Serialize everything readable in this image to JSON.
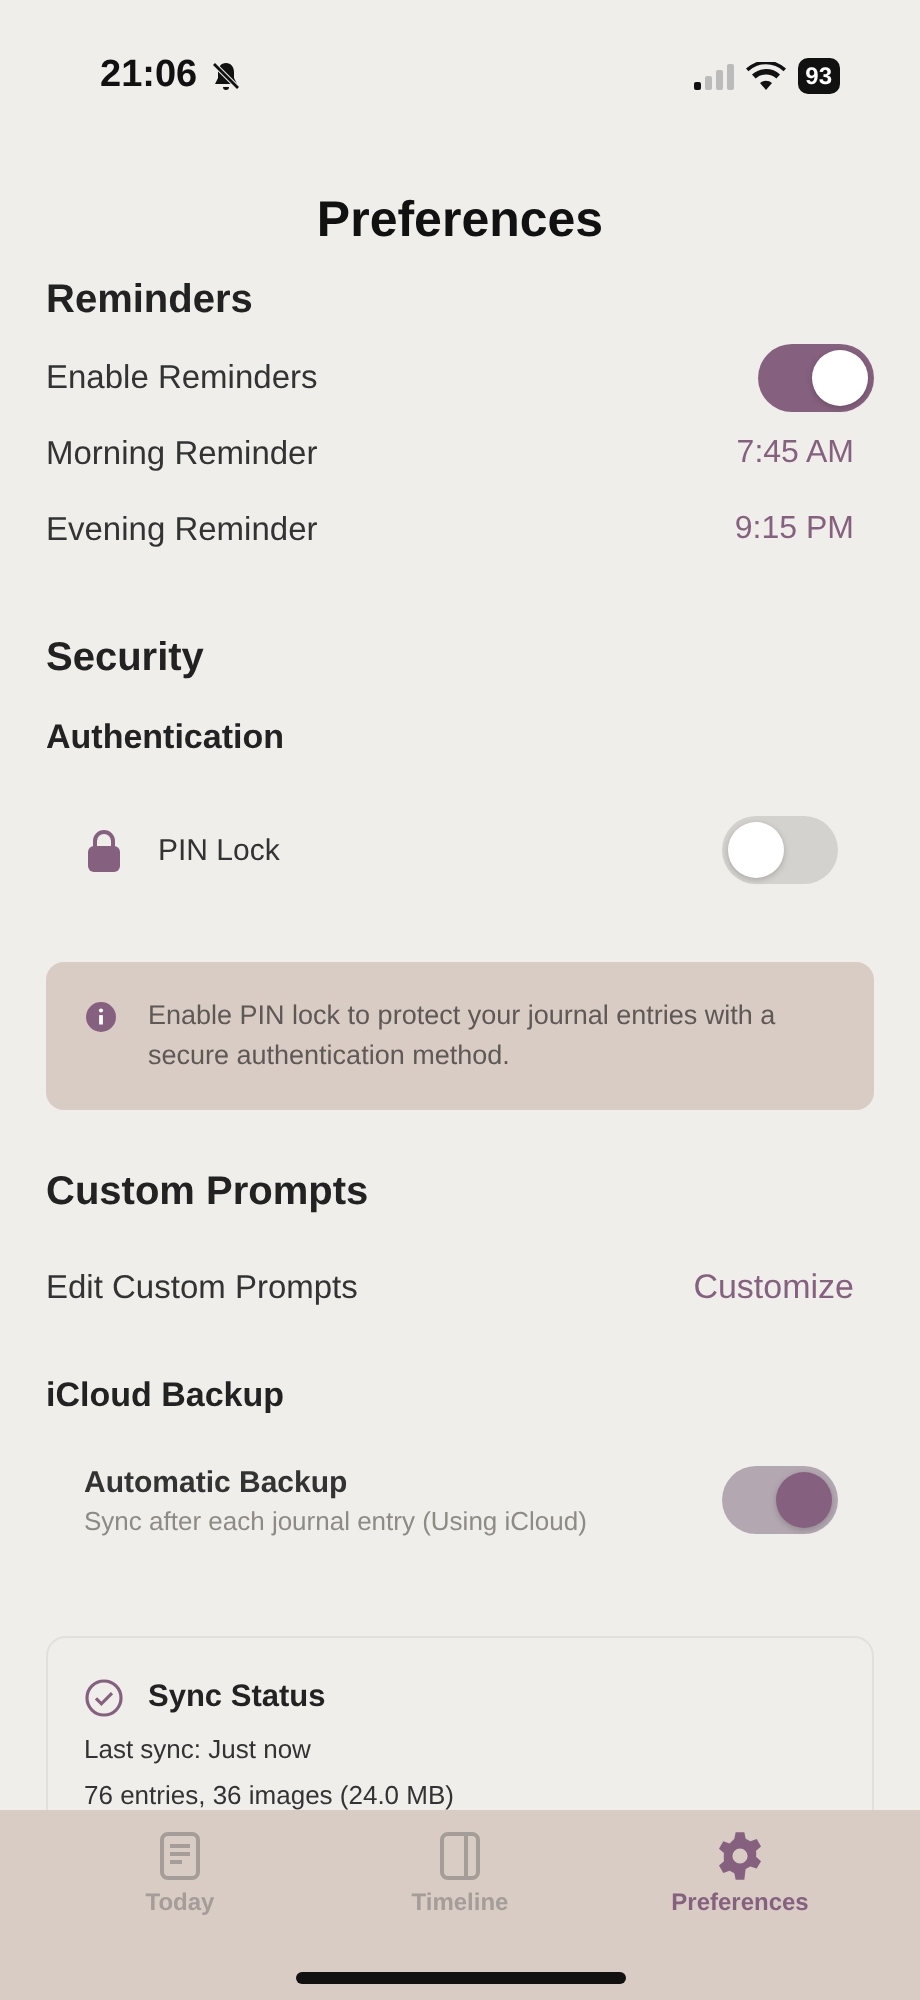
{
  "status_bar": {
    "time": "21:06",
    "silent": true,
    "battery": "93"
  },
  "title": "Preferences",
  "reminders": {
    "heading": "Reminders",
    "rows": [
      {
        "kind": "toggle",
        "label": "Enable Reminders",
        "on": true
      },
      {
        "kind": "time",
        "label": "Morning Reminder",
        "value": "7:45 AM"
      },
      {
        "kind": "time",
        "label": "Evening Reminder",
        "value": "9:15 PM"
      }
    ]
  },
  "security": {
    "heading": "Security",
    "subheading": "Authentication",
    "pin_lock": {
      "label": "PIN Lock",
      "on": false
    },
    "info": "Enable PIN lock to protect your journal entries with a secure authentication method."
  },
  "custom_prompts": {
    "heading": "Custom Prompts",
    "label": "Edit Custom Prompts",
    "action": "Customize"
  },
  "icloud_backup": {
    "heading": "iCloud Backup",
    "automatic_backup": {
      "label": "Automatic Backup",
      "description": "Sync after each journal entry (Using iCloud)",
      "on": true
    },
    "sync_status": {
      "title": "Sync Status",
      "lines": [
        "Last sync: Just now",
        "76 entries, 36 images (24.0 MB)"
      ]
    }
  },
  "tabs": [
    {
      "kind": "today",
      "label": "Today",
      "selected": false
    },
    {
      "kind": "timeline",
      "label": "Timeline",
      "selected": false
    },
    {
      "kind": "preferences",
      "label": "Preferences",
      "selected": true
    }
  ]
}
